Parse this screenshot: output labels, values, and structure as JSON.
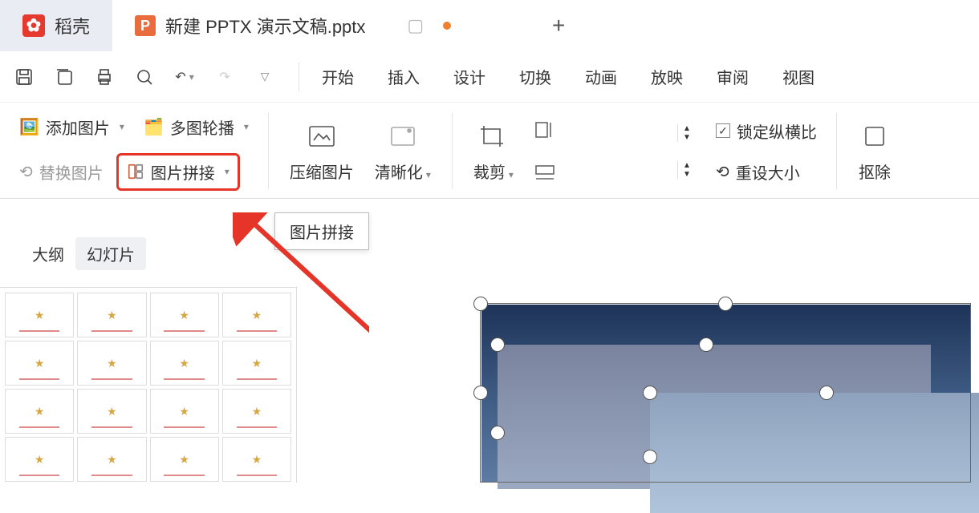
{
  "tabs": {
    "docer": "稻壳",
    "doc_title": "新建 PPTX 演示文稿.pptx",
    "plus": "+"
  },
  "menu": [
    "开始",
    "插入",
    "设计",
    "切换",
    "动画",
    "放映",
    "审阅",
    "视图"
  ],
  "ribbon": {
    "add_image": "添加图片",
    "multi_carousel": "多图轮播",
    "replace_image": "替换图片",
    "image_stitch": "图片拼接",
    "compress": "压缩图片",
    "clarity": "清晰化",
    "crop": "裁剪",
    "lock_ratio": "锁定纵横比",
    "reset_size": "重设大小",
    "cutout": "抠除"
  },
  "tooltip": "图片拼接",
  "panel": {
    "outline": "大纲",
    "slides": "幻灯片"
  }
}
